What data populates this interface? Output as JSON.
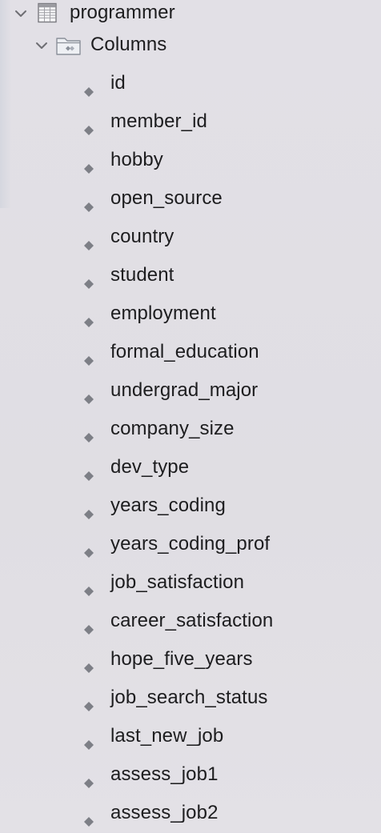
{
  "tree": {
    "table": {
      "name": "programmer",
      "icon": "table-icon",
      "expanded": true
    },
    "folder": {
      "name": "Columns",
      "icon": "folder-icon",
      "expanded": true
    },
    "columns": [
      "id",
      "member_id",
      "hobby",
      "open_source",
      "country",
      "student",
      "employment",
      "formal_education",
      "undergrad_major",
      "company_size",
      "dev_type",
      "years_coding",
      "years_coding_prof",
      "job_satisfaction",
      "career_satisfaction",
      "hope_five_years",
      "job_search_status",
      "last_new_job",
      "assess_job1",
      "assess_job2"
    ],
    "column_icon": "column-diamond-icon"
  }
}
